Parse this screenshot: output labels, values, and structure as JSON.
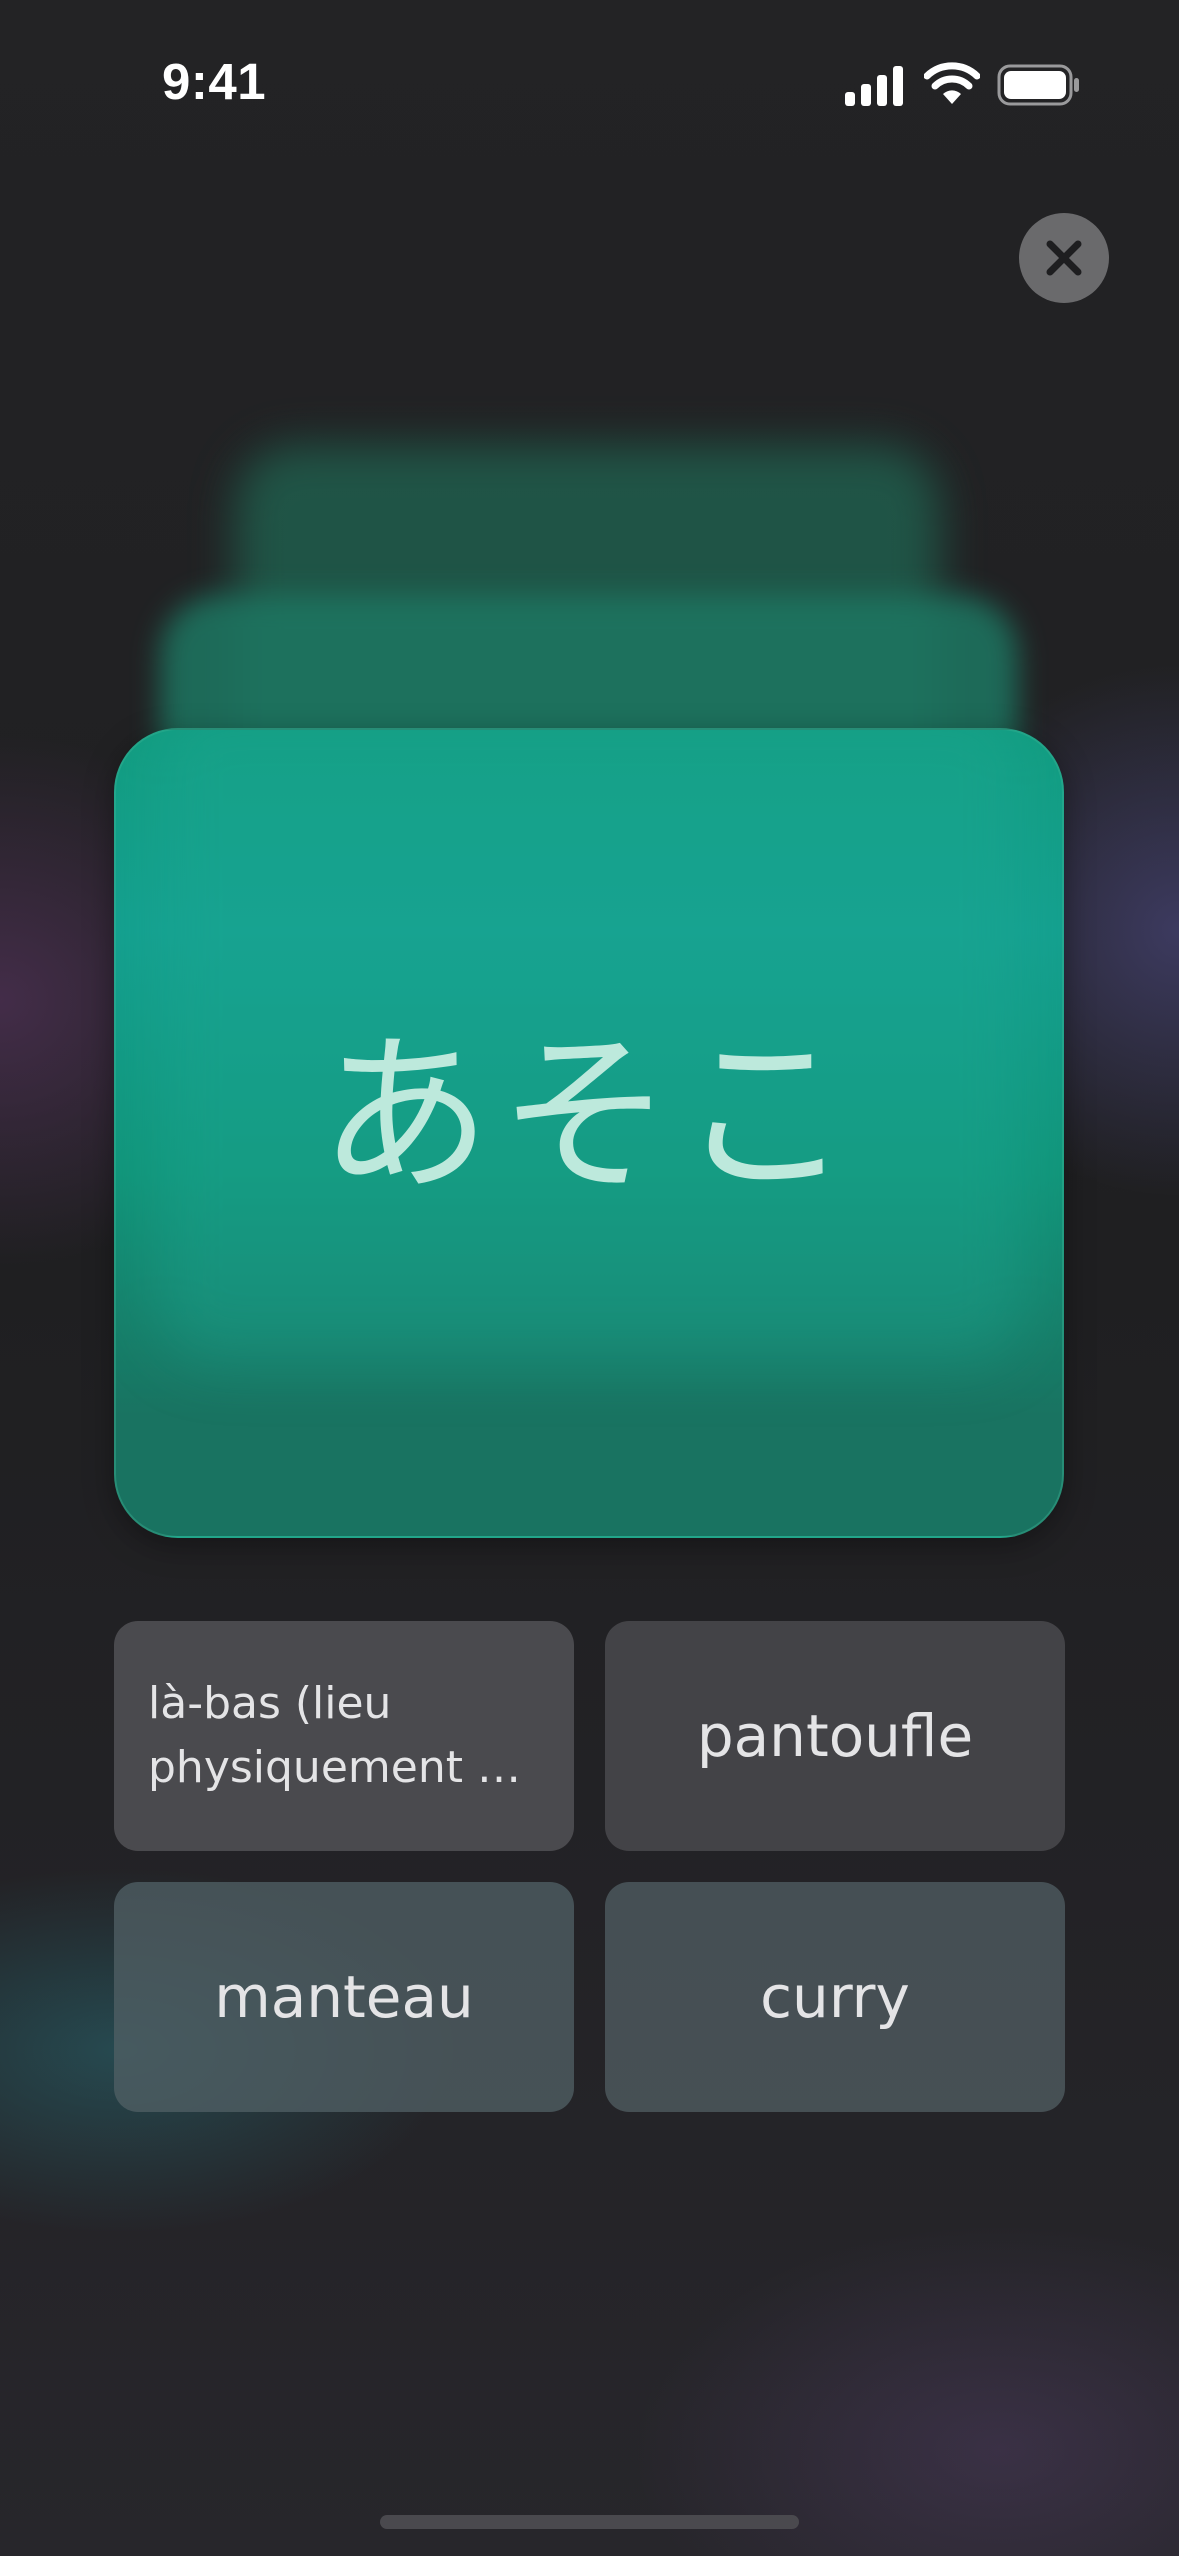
{
  "status_bar": {
    "time": "9:41",
    "signal_icon": "cellular-signal-icon",
    "wifi_icon": "wifi-icon",
    "battery_icon": "battery-icon"
  },
  "close_button": {
    "icon": "close-icon"
  },
  "card": {
    "term": "あそこ",
    "color": "#129c80"
  },
  "answers": [
    {
      "line1": "là-bas (lieu",
      "line2": "physiquement él..."
    },
    {
      "label": "pantoufle"
    },
    {
      "label": "manteau"
    },
    {
      "label": "curry"
    }
  ]
}
